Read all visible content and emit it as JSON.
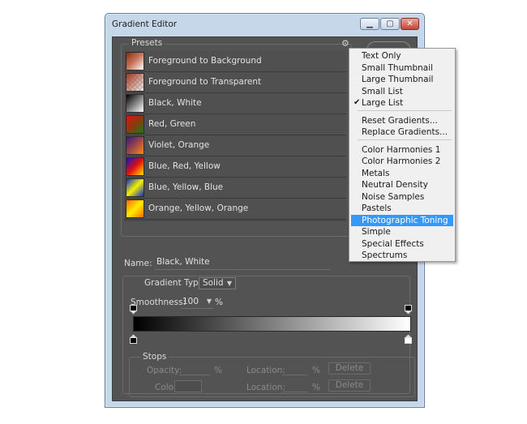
{
  "window": {
    "title": "Gradient Editor"
  },
  "presets": {
    "label": "Presets",
    "items": [
      {
        "label": "Foreground to Background",
        "c1": "#8a2812",
        "c2": "#c97a60",
        "c3": "#ffffff"
      },
      {
        "label": "Foreground to Transparent",
        "transparent": true,
        "c1": "#a5371e",
        "c2": "#c98a78",
        "c3": "#efefef"
      },
      {
        "label": "Black, White",
        "c1": "#000000",
        "c2": "#7f7f7f",
        "c3": "#ffffff"
      },
      {
        "label": "Red, Green",
        "c1": "#e01010",
        "c2": "#8a3a10",
        "c3": "#1a7a1a"
      },
      {
        "label": "Violet, Orange",
        "c1": "#3a1878",
        "c2": "#9a4848",
        "c3": "#ff8a10"
      },
      {
        "label": "Blue, Red, Yellow",
        "c1": "#1010d0",
        "c2": "#e01010",
        "c3": "#ffe400"
      },
      {
        "label": "Blue, Yellow, Blue",
        "c1": "#0a2ad0",
        "c2": "#f4f000",
        "c3": "#0a2ad0"
      },
      {
        "label": "Orange, Yellow, Orange",
        "c1": "#ff6a00",
        "c2": "#ffee00",
        "c3": "#ff6a00"
      }
    ]
  },
  "name": {
    "label": "Name:",
    "value": "Black, White"
  },
  "gradient_type": {
    "label": "Gradient Type:",
    "value": "Solid"
  },
  "smoothness": {
    "label": "Smoothness:",
    "value": "100",
    "unit": "%"
  },
  "stops": {
    "label": "Stops",
    "opacity_label": "Opacity:",
    "color_label": "Color:",
    "location_label": "Location:",
    "unit": "%",
    "delete_label": "Delete"
  },
  "menu": {
    "items": [
      {
        "label": "Text Only"
      },
      {
        "label": "Small Thumbnail"
      },
      {
        "label": "Large Thumbnail"
      },
      {
        "label": "Small List"
      },
      {
        "label": "Large List",
        "checked": true
      },
      {
        "label": "Reset Gradients..."
      },
      {
        "label": "Replace Gradients..."
      },
      {
        "label": "Color Harmonies 1"
      },
      {
        "label": "Color Harmonies 2"
      },
      {
        "label": "Metals"
      },
      {
        "label": "Neutral Density"
      },
      {
        "label": "Noise Samples"
      },
      {
        "label": "Pastels"
      },
      {
        "label": "Photographic Toning",
        "highlighted": true
      },
      {
        "label": "Simple"
      },
      {
        "label": "Special Effects"
      },
      {
        "label": "Spectrums"
      }
    ],
    "check_mark": "✔"
  }
}
